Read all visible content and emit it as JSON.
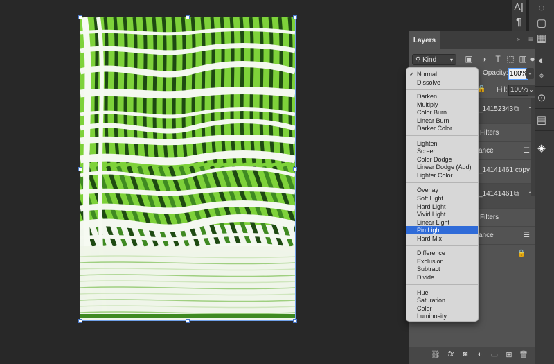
{
  "layers_panel": {
    "tab_label": "Layers",
    "kind_label": "Kind",
    "opacity_label": "Opacity:",
    "opacity_value": "100%",
    "fill_label": "Fill:",
    "fill_value": "100%",
    "layers": [
      {
        "name": "_14152343",
        "kind": "group"
      },
      {
        "name": "Filters",
        "kind": "sub"
      },
      {
        "name": "ance",
        "kind": "sub"
      },
      {
        "name": "_14141461 copy",
        "kind": "layer"
      },
      {
        "name": "_14141461",
        "kind": "group"
      },
      {
        "name": "Filters",
        "kind": "sub"
      },
      {
        "name": "ance",
        "kind": "sub"
      },
      {
        "name": "",
        "kind": "background"
      }
    ]
  },
  "blend_menu": {
    "checked_item": "Normal",
    "highlighted_item": "Pin Light",
    "groups": [
      [
        "Normal",
        "Dissolve"
      ],
      [
        "Darken",
        "Multiply",
        "Color Burn",
        "Linear Burn",
        "Darker Color"
      ],
      [
        "Lighten",
        "Screen",
        "Color Dodge",
        "Linear Dodge (Add)",
        "Lighter Color"
      ],
      [
        "Overlay",
        "Soft Light",
        "Hard Light",
        "Vivid Light",
        "Linear Light",
        "Pin Light",
        "Hard Mix"
      ],
      [
        "Difference",
        "Exclusion",
        "Subtract",
        "Divide"
      ],
      [
        "Hue",
        "Saturation",
        "Color",
        "Luminosity"
      ]
    ]
  },
  "right_strip": {
    "char_panel_glyph": "A|",
    "paragraph_glyph": "¶"
  },
  "icons": {
    "check": "✓",
    "chevron": "⌄",
    "lock": "🔒"
  },
  "colors": {
    "accent": "#2f6bd8",
    "artwork_green": "#7ed23a",
    "artwork_dark": "#1e4a12"
  }
}
